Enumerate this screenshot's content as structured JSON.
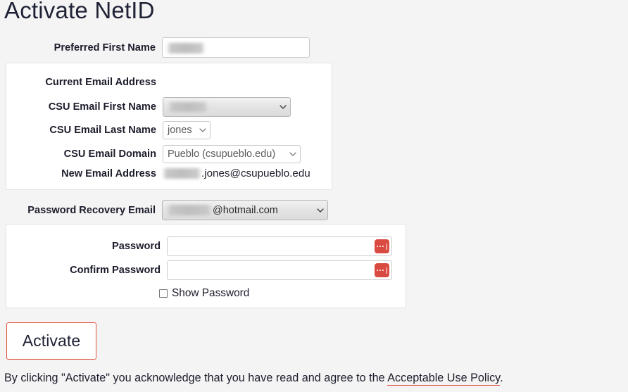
{
  "page": {
    "title": "Activate NetID",
    "background_color": "#f4f4f4",
    "accent_color": "#e0523f",
    "password_icon_color": "#d94a41"
  },
  "preferred_first_name": {
    "label": "Preferred First Name",
    "value": "",
    "redacted": true
  },
  "email_fieldset": {
    "heading": "Current Email Address",
    "rows": [
      {
        "label": "CSU Email First Name",
        "control": "select",
        "value": "",
        "redacted": true
      },
      {
        "label": "CSU Email Last Name",
        "control": "select",
        "value": "jones",
        "redacted": false
      },
      {
        "label": "CSU Email Domain",
        "control": "select",
        "value": "Pueblo (csupueblo.edu)",
        "redacted": false
      },
      {
        "label": "New Email Address",
        "control": "static",
        "value": ".jones@csupueblo.edu",
        "redacted": true
      }
    ]
  },
  "password_recovery": {
    "label": "Password Recovery Email",
    "value": "@hotmail.com",
    "redacted": true
  },
  "password_fieldset": {
    "password": {
      "label": "Password",
      "value": "",
      "fill_icon": "password-fill-icon"
    },
    "confirm_password": {
      "label": "Confirm Password",
      "value": "",
      "fill_icon": "password-fill-icon"
    },
    "show_password": {
      "label": "Show Password",
      "checked": false
    }
  },
  "actions": {
    "activate_label": "Activate"
  },
  "footer": {
    "text_before": "By clicking \"Activate\" you acknowledge that you have read and agree to the ",
    "link_label": "Acceptable Use Policy",
    "text_after": "."
  }
}
